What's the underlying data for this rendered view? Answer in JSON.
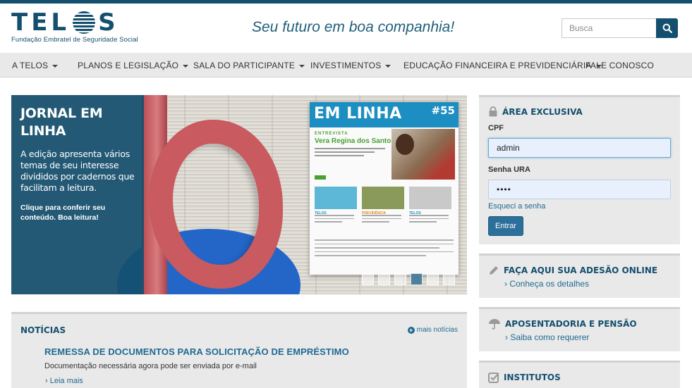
{
  "brand": {
    "logo_text": "TELOS",
    "logo_subtitle": "Fundação Embratel de Seguridade Social",
    "tagline": "Seu futuro em boa companhia!"
  },
  "search": {
    "placeholder": "Busca",
    "icon": "search-icon"
  },
  "nav": {
    "items": [
      {
        "label": "A TELOS",
        "has_dropdown": true
      },
      {
        "label": "PLANOS E LEGISLAÇÃO",
        "has_dropdown": true
      },
      {
        "label": "SALA DO PARTICIPANTE",
        "has_dropdown": true
      },
      {
        "label": "INVESTIMENTOS",
        "has_dropdown": true
      },
      {
        "label": "EDUCAÇÃO FINANCEIRA E PREVIDENCIÁRIA",
        "has_dropdown": true
      },
      {
        "label": "FALE CONOSCO",
        "has_dropdown": false
      }
    ]
  },
  "hero": {
    "title": "JORNAL EM LINHA",
    "description": "A edição apresenta vários temas de seu interesse divididos por cadernos que facilitam a leitura.",
    "cta": "Clique para conferir seu conteúdo. Boa leitura!",
    "magazine": {
      "title": "EM LINHA",
      "issue": "#55",
      "section": "ENTREVISTA",
      "headline": "Vera Regina dos Santos",
      "tag1": "TELOS",
      "tag2": "PREVIDÊNCIA",
      "tag3": "TELOS"
    },
    "slides": {
      "count": 6,
      "active_index": 4
    }
  },
  "news": {
    "title": "NOTÍCIAS",
    "more_label": "mais notícias",
    "items": [
      {
        "headline": "REMESSA DE DOCUMENTOS PARA SOLICITAÇÃO DE EMPRÉSTIMO",
        "description": "Documentação necessária agora pode ser enviada por e-mail",
        "link": "› Leia mais"
      }
    ]
  },
  "login": {
    "title": "ÁREA EXCLUSIVA",
    "cpf_label": "CPF",
    "cpf_value": "admin",
    "password_label": "Senha URA",
    "password_value": "••••",
    "forgot_link": "Esqueci a senha",
    "submit_label": "Entrar"
  },
  "cards": [
    {
      "title": "FAÇA AQUI SUA ADESÃO ONLINE",
      "link": "› Conheça os detalhes",
      "icon": "pencil-icon"
    },
    {
      "title": "APOSENTADORIA E PENSÃO",
      "link": "› Saiba como requerer",
      "icon": "umbrella-icon"
    },
    {
      "title": "INSTITUTOS",
      "link": "",
      "icon": "checkbox-icon"
    }
  ],
  "colors": {
    "brand": "#14506e",
    "link": "#1f6a92",
    "nav_bg": "#e9e9e9"
  }
}
